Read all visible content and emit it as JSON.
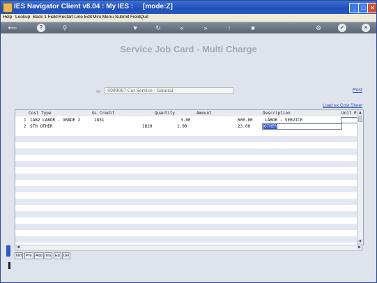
{
  "window": {
    "title": "IES Navigator Client v8.04 : My IES :     [mode:Z]",
    "buttons": [
      "minimize",
      "maximize",
      "close"
    ]
  },
  "menu": [
    "Help",
    "Lookup",
    "Back 1 Field",
    "Restart Line Edit",
    "Mini Menu",
    "Submit Field",
    "Quit"
  ],
  "toolbar_icons": [
    "back-icon",
    "help-icon",
    "search-icon",
    "heart-icon",
    "refresh-icon",
    "rewind-icon",
    "fast-forward-icon",
    "up-icon",
    "stop-icon",
    "gear-icon",
    "check-icon",
    "close-icon"
  ],
  "page": {
    "heading": "Service Job Card - Multi Charge",
    "job_prefix": "ON",
    "job_value": "S000087 Car Service - General",
    "post_link": "Post",
    "load_link": "Load ex Cost Sheet"
  },
  "grid": {
    "columns": [
      "Cost Type",
      "GL Credit",
      "Quantity",
      "Amount",
      "Description",
      "Unit P"
    ],
    "rows": [
      {
        "num": "1",
        "cost_type": "1AB2 LABOR - GRADE 2",
        "gl_credit": "1831",
        "quantity": "3.00",
        "amount": "600.00",
        "description": "LABOR - SERVICE"
      },
      {
        "num": "2",
        "cost_type": "STH OTHER",
        "gl_credit": "1820",
        "quantity": "1.00",
        "amount": "23.00",
        "description": "OTHER"
      }
    ]
  },
  "bottom_buttons": [
    "Nxt",
    "Pre",
    "Add",
    "Ins",
    "Ed",
    "Del"
  ]
}
